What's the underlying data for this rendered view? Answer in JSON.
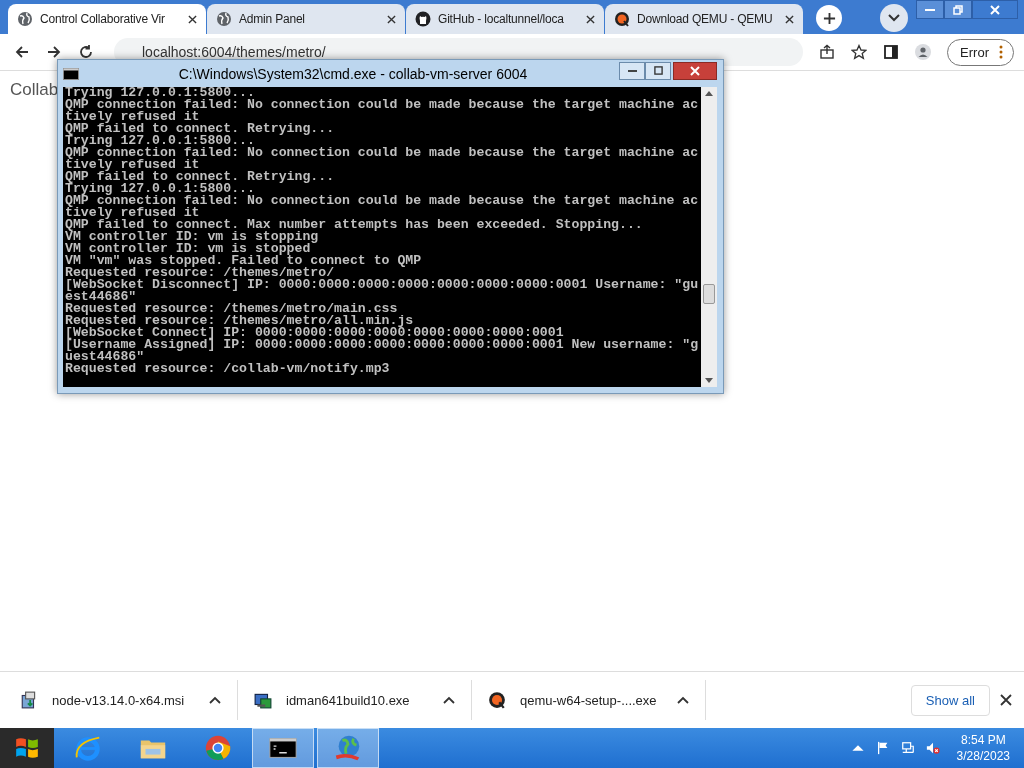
{
  "browser": {
    "tabs": [
      {
        "title": "Control Collaborative Vir",
        "kind": "globe",
        "selected": true
      },
      {
        "title": "Admin Panel",
        "kind": "globe",
        "selected": false
      },
      {
        "title": "GitHub - localtunnel/loca",
        "kind": "github",
        "selected": false
      },
      {
        "title": "Download QEMU - QEMU",
        "kind": "qemu",
        "selected": false
      }
    ],
    "address": "localhost:6004/themes/metro/",
    "profile_button": "Error",
    "page_text": "Collab"
  },
  "console": {
    "title": "C:\\Windows\\System32\\cmd.exe - collab-vm-server  6004",
    "lines": [
      "Trying 127.0.0.1:5800...",
      "QMP connection failed: No connection could be made because the target machine ac",
      "tively refused it",
      "QMP failed to connect. Retrying...",
      "Trying 127.0.0.1:5800...",
      "QMP connection failed: No connection could be made because the target machine ac",
      "tively refused it",
      "QMP failed to connect. Retrying...",
      "Trying 127.0.0.1:5800...",
      "QMP connection failed: No connection could be made because the target machine ac",
      "tively refused it",
      "QMP failed to connect. Max number attempts has been exceeded. Stopping...",
      "VM controller ID: vm is stopping",
      "VM controller ID: vm is stopped",
      "VM \"vm\" was stopped. Failed to connect to QMP",
      "Requested resource: /themes/metro/",
      "[WebSocket Disconnect] IP: 0000:0000:0000:0000:0000:0000:0000:0001 Username: \"gu",
      "est44686\"",
      "Requested resource: /themes/metro/main.css",
      "Requested resource: /themes/metro/all.min.js",
      "[WebSocket Connect] IP: 0000:0000:0000:0000:0000:0000:0000:0001",
      "[Username Assigned] IP: 0000:0000:0000:0000:0000:0000:0000:0001 New username: \"g",
      "uest44686\"",
      "Requested resource: /collab-vm/notify.mp3"
    ]
  },
  "downloads": {
    "items": [
      {
        "name": "node-v13.14.0-x64.msi",
        "kind": "installer"
      },
      {
        "name": "idman641build10.exe",
        "kind": "setup"
      },
      {
        "name": "qemu-w64-setup-....exe",
        "kind": "qemu"
      }
    ],
    "show_all": "Show all"
  },
  "taskbar": {
    "apps": [
      {
        "kind": "ie",
        "selected": false
      },
      {
        "kind": "folder",
        "selected": false
      },
      {
        "kind": "chrome",
        "selected": false
      },
      {
        "kind": "cmd",
        "selected": true
      },
      {
        "kind": "globe",
        "selected": true
      }
    ],
    "time": "8:54 PM",
    "date": "3/28/2023"
  }
}
